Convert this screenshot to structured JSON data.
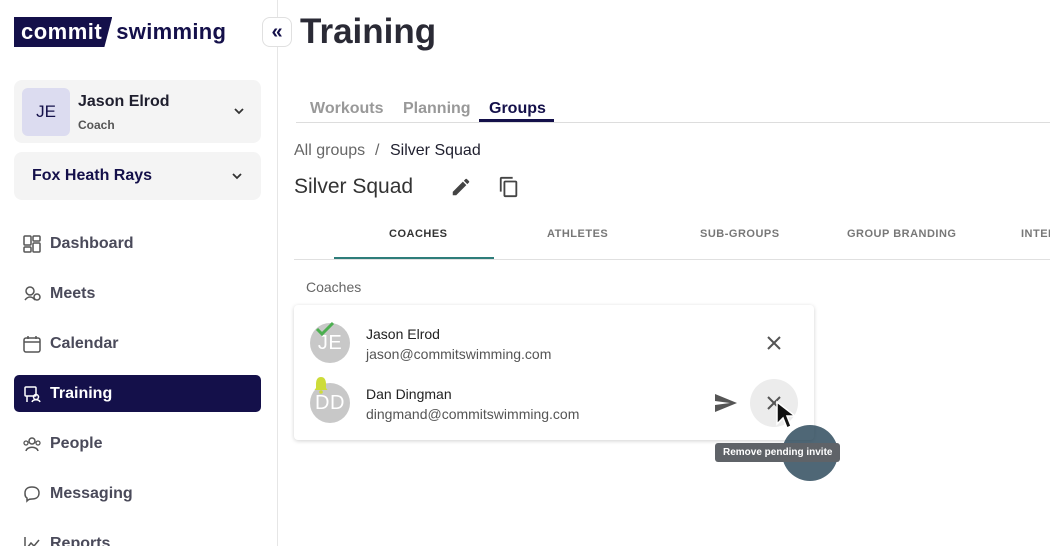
{
  "logo": {
    "part1": "commit",
    "part2": "swimming"
  },
  "collapse_symbol": "«",
  "user": {
    "initials": "JE",
    "name": "Jason Elrod",
    "role": "Coach"
  },
  "team": {
    "name": "Fox Heath Rays"
  },
  "nav": [
    {
      "label": "Dashboard",
      "icon": "dashboard-icon"
    },
    {
      "label": "Meets",
      "icon": "meets-icon"
    },
    {
      "label": "Calendar",
      "icon": "calendar-icon"
    },
    {
      "label": "Training",
      "icon": "training-icon",
      "active": true
    },
    {
      "label": "People",
      "icon": "people-icon"
    },
    {
      "label": "Messaging",
      "icon": "messaging-icon"
    },
    {
      "label": "Reports",
      "icon": "reports-icon"
    }
  ],
  "page_title": "Training",
  "top_tabs": [
    {
      "label": "Workouts"
    },
    {
      "label": "Planning"
    },
    {
      "label": "Groups",
      "active": true
    }
  ],
  "breadcrumb": {
    "root": "All groups",
    "separator": "/",
    "current": "Silver Squad"
  },
  "group": {
    "title": "Silver Squad"
  },
  "sub_tabs": [
    {
      "label": "COACHES",
      "active": true
    },
    {
      "label": "ATHLETES"
    },
    {
      "label": "SUB-GROUPS"
    },
    {
      "label": "GROUP BRANDING"
    },
    {
      "label": "INTEN"
    }
  ],
  "section_label": "Coaches",
  "coaches": [
    {
      "initials": "JE",
      "name": "Jason Elrod",
      "email": "jason@commitswimming.com",
      "status": "accepted",
      "badge_color": "#4caf50"
    },
    {
      "initials": "DD",
      "name": "Dan Dingman",
      "email": "dingmand@commitswimming.com",
      "status": "pending",
      "badge_color": "#cddc39"
    }
  ],
  "tooltip": "Remove pending invite",
  "colors": {
    "brand": "#14104a",
    "accent_tab": "#2e7d7a"
  }
}
